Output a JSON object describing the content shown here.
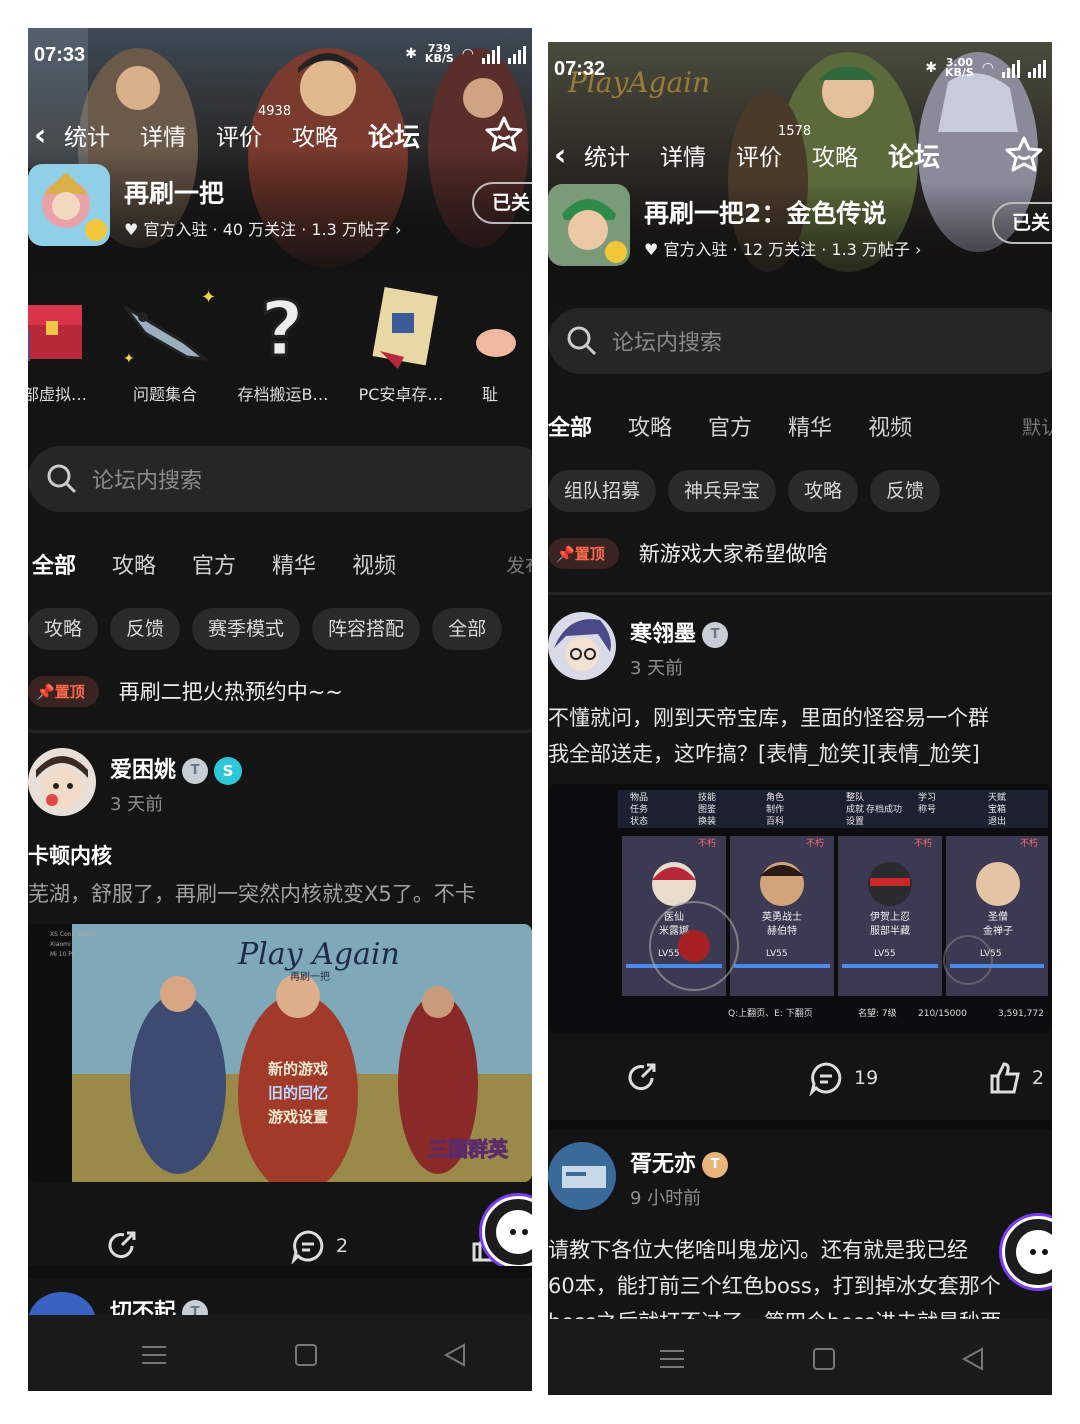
{
  "left": {
    "status": {
      "time": "07:33",
      "netspeed_value": "739",
      "netspeed_unit": "KB/S"
    },
    "nav": {
      "tabs": [
        "统计",
        "详情",
        "评价",
        "攻略",
        "论坛"
      ],
      "review_count": "4938"
    },
    "game": {
      "title": "再刷一把",
      "meta": "官方入驻 · 40 万关注 · 1.3 万帖子 ›",
      "follow_label": "已关"
    },
    "categories": [
      "外部虚拟…",
      "问题集合",
      "存档搬运B…",
      "PC安卓存…",
      "耻"
    ],
    "search_placeholder": "论坛内搜索",
    "feed_tabs": [
      "全部",
      "攻略",
      "官方",
      "精华",
      "视频"
    ],
    "sort_label": "发布",
    "chips": [
      "攻略",
      "反馈",
      "赛季模式",
      "阵容搭配",
      "全部"
    ],
    "pinned": {
      "tag": "置顶",
      "text": "再刷二把火热预约中~~"
    },
    "post1": {
      "user": "爱困姚",
      "time": "3 天前",
      "title": "卡顿内核",
      "body": "芜湖，舒服了，再刷一突然内核就变X5了。不卡",
      "comments": "2",
      "image_title": "Play Again",
      "image_subtitle": "再刷一把",
      "menu": [
        "新的游戏",
        "旧的回忆",
        "游戏设置"
      ],
      "watermark": "三国群英",
      "device_lines": [
        "XS Conn 46295",
        "Xiaomi",
        "Mi 10 Pr"
      ]
    },
    "post2": {
      "user": "切不起"
    }
  },
  "right": {
    "status": {
      "time": "07:32",
      "netspeed_value": "3.00",
      "netspeed_unit": "KB/S"
    },
    "nav": {
      "tabs": [
        "统计",
        "详情",
        "评价",
        "攻略",
        "论坛"
      ],
      "review_count": "1578"
    },
    "game": {
      "title": "再刷一把2：金色传说",
      "meta": "官方入驻 · 12 万关注 · 1.3 万帖子 ›",
      "follow_label": "已关"
    },
    "search_placeholder": "论坛内搜索",
    "feed_tabs": [
      "全部",
      "攻略",
      "官方",
      "精华",
      "视频"
    ],
    "sort_label": "默认",
    "chips": [
      "组队招募",
      "神兵异宝",
      "攻略",
      "反馈"
    ],
    "pinned": {
      "tag": "置顶",
      "text": "新游戏大家希望做啥"
    },
    "post1": {
      "user": "寒翎墨",
      "time": "3 天前",
      "body_lines": [
        "不懂就问，刚到天帝宝库，里面的怪容易一个群",
        "我全部送走，这咋搞？[表情_尬笑][表情_尬笑]"
      ],
      "comments": "19",
      "likes": "2",
      "game_menu": [
        "物品",
        "技能",
        "角色",
        "整队",
        "学习",
        "天赋",
        "任务",
        "图鉴",
        "制作",
        "成就",
        "存档成功",
        "称号",
        "宝箱",
        "状态",
        "换装",
        "百科",
        "设置",
        "退出"
      ],
      "heroes": [
        {
          "role": "医仙",
          "name": "米露娜",
          "tag": "不朽"
        },
        {
          "role": "英勇战士",
          "name": "赫伯特",
          "tag": "不朽"
        },
        {
          "role": "伊贺上忍",
          "name": "服部半藏",
          "tag": "不朽"
        },
        {
          "role": "圣僧",
          "name": "金禅子",
          "tag": "不朽"
        }
      ],
      "hero_level": "LV55",
      "footer": "Q:上翻页、E: 下翻页",
      "fame": "名望: 7级",
      "progress": "210/15000",
      "gold": "3,591,772"
    },
    "post2": {
      "user": "胥无亦",
      "time": "9 小时前",
      "body_lines": [
        "请教下各位大佬啥叫鬼龙闪。还有就是我已经",
        "60本，能打前三个红色boss，打到掉冰女套那个",
        "boss之后就打不过了，第四个boss进去就是秒两"
      ]
    }
  }
}
